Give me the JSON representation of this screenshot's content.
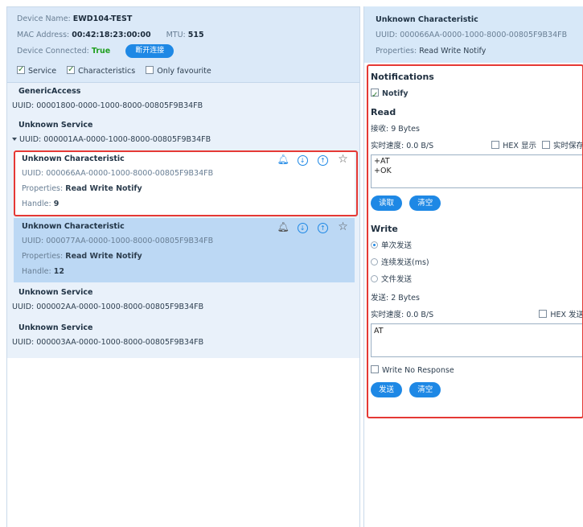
{
  "device": {
    "name_label": "Device Name:",
    "name": "EWD104-TEST",
    "mac_label": "MAC Address:",
    "mac": "00:42:18:23:00:00",
    "mtu_label": "MTU:",
    "mtu": "515",
    "connected_label": "Device Connected:",
    "connected": "True",
    "disconnect_label": "断开连接"
  },
  "filters": {
    "service": "Service",
    "characteristics": "Characteristics",
    "only_favourite": "Only favourite"
  },
  "services": [
    {
      "title": "GenericAccess",
      "uuid": "UUID: 00001800-0000-1000-8000-00805F9B34FB"
    },
    {
      "title": "Unknown Service",
      "uuid": "UUID: 000001AA-0000-1000-8000-00805F9B34FB"
    },
    {
      "title": "Unknown Service",
      "uuid": "UUID: 000002AA-0000-1000-8000-00805F9B34FB"
    },
    {
      "title": "Unknown Service",
      "uuid": "UUID: 000003AA-0000-1000-8000-00805F9B34FB"
    }
  ],
  "characteristics": [
    {
      "title": "Unknown Characteristic",
      "uuid": "UUID: 000066AA-0000-1000-8000-00805F9B34FB",
      "props_label": "Properties:",
      "props": "Read Write Notify",
      "handle_label": "Handle:",
      "handle": "9"
    },
    {
      "title": "Unknown Characteristic",
      "uuid": "UUID: 000077AA-0000-1000-8000-00805F9B34FB",
      "props_label": "Properties:",
      "props": "Read Write Notify",
      "handle_label": "Handle:",
      "handle": "12"
    }
  ],
  "detail": {
    "title": "Unknown Characteristic",
    "uuid": "UUID: 000066AA-0000-1000-8000-00805F9B34FB",
    "props_label": "Properties:",
    "props": "Read Write Notify",
    "notifications_title": "Notifications",
    "notify_label": "Notify",
    "read_title": "Read",
    "recv": "接收:  9 Bytes",
    "read_speed": "实时速度:  0.0 B/S",
    "hex_display": "HEX 显示",
    "realtime_save": "实时保存",
    "read_lines": [
      "+AT",
      "+OK"
    ],
    "read_btn": "读取",
    "clear_btn": "清空",
    "write_title": "Write",
    "mode_single": "单次发送",
    "mode_continuous": "连续发送(ms)",
    "mode_file": "文件发送",
    "sent": "发送:  2 Bytes",
    "write_speed": "实时速度:  0.0 B/S",
    "hex_send": "HEX 发送",
    "write_value": "AT",
    "write_no_response": "Write No Response",
    "send_btn": "发送",
    "clear_btn2": "清空"
  },
  "colors": {
    "accent": "#1e88e5",
    "highlight": "#e53935",
    "selected_bg": "#bcd8f4"
  }
}
